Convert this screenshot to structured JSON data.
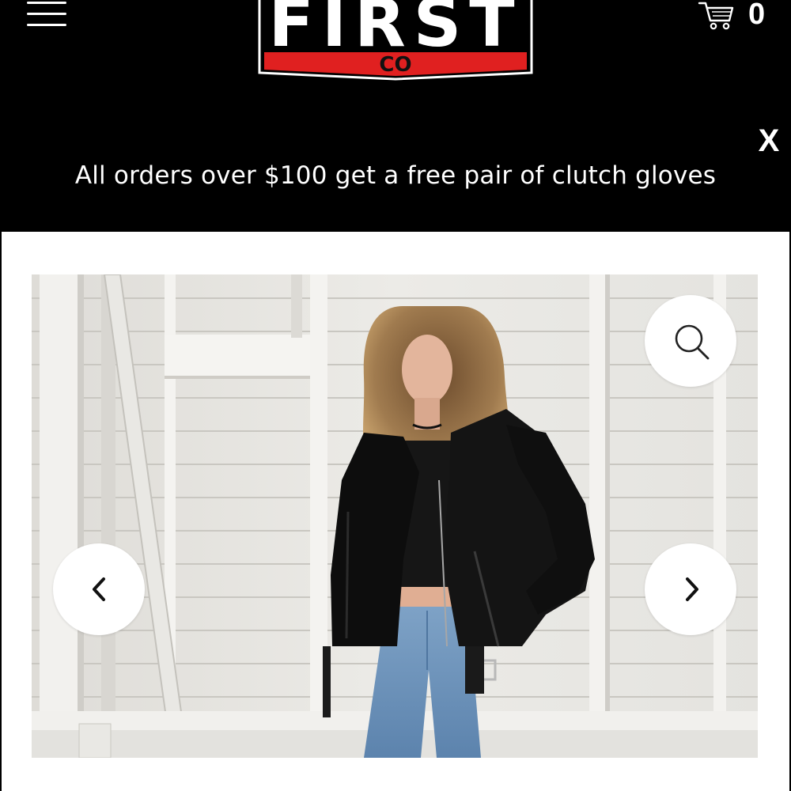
{
  "header": {
    "logo": {
      "text": "FIRST",
      "sub_text": "CO",
      "colors": {
        "band": "#e02020",
        "outline": "#ffffff",
        "letters": "#ffffff",
        "sub_text": "#111111"
      }
    },
    "menu_icon": "hamburger-menu-icon",
    "cart": {
      "icon": "shopping-cart-icon",
      "count": "0"
    }
  },
  "announcement": {
    "text": "All orders over $100 get a free pair of clutch gloves",
    "close_label": "X"
  },
  "product_gallery": {
    "image_alt": "Woman wearing a black leather moto jacket, black crop top and blue jeans",
    "controls": {
      "zoom_icon": "magnifier-icon",
      "prev_icon": "chevron-left-icon",
      "next_icon": "chevron-right-icon"
    }
  },
  "colors": {
    "header_bg": "#000000",
    "page_bg": "#ffffff",
    "button_bg": "#ffffff"
  }
}
